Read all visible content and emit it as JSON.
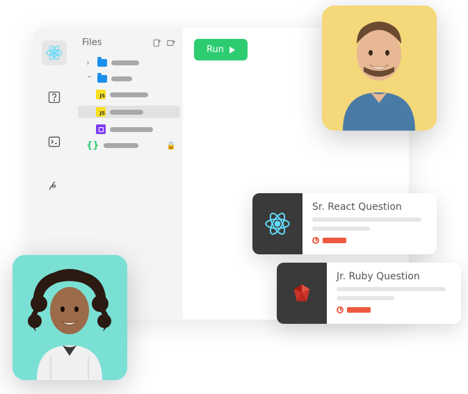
{
  "ide": {
    "files_label": "Files",
    "run_label": "Run",
    "tree": {
      "file3_badge": "JS",
      "file4_badge": "JS"
    }
  },
  "cards": [
    {
      "title": "Sr. React Question"
    },
    {
      "title": "Jr. Ruby Question"
    }
  ]
}
